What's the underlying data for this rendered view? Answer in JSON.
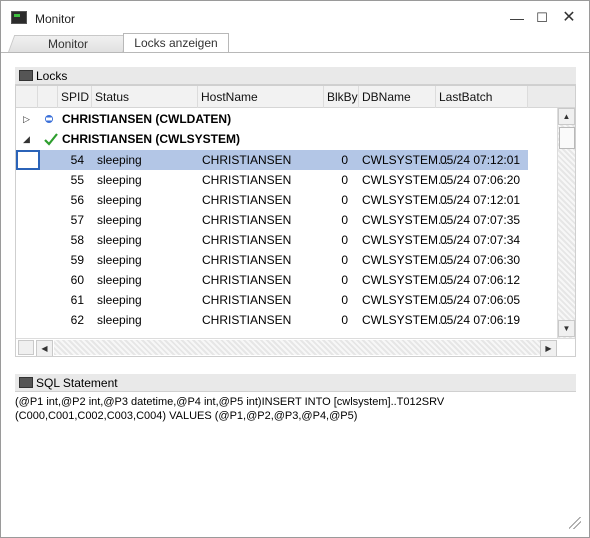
{
  "window": {
    "title": "Monitor"
  },
  "tabs": [
    {
      "label": "Monitor",
      "active": false
    },
    {
      "label": "Locks anzeigen",
      "active": true
    }
  ],
  "locks": {
    "title": "Locks",
    "columns": [
      "SPID",
      "Status",
      "HostName",
      "BlkBy",
      "DBName",
      "LastBatch"
    ],
    "groups": [
      {
        "label": "CHRISTIANSEN (CWLDATEN)",
        "expanded": false
      },
      {
        "label": "CHRISTIANSEN (CWLSYSTEM)",
        "expanded": true
      }
    ],
    "rows": [
      {
        "spid": "54",
        "status": "sleeping",
        "host": "CHRISTIANSEN",
        "blkby": "0",
        "db": "CWLSYSTEM...",
        "last": "05/24 07:12:01"
      },
      {
        "spid": "55",
        "status": "sleeping",
        "host": "CHRISTIANSEN",
        "blkby": "0",
        "db": "CWLSYSTEM...",
        "last": "05/24 07:06:20"
      },
      {
        "spid": "56",
        "status": "sleeping",
        "host": "CHRISTIANSEN",
        "blkby": "0",
        "db": "CWLSYSTEM...",
        "last": "05/24 07:12:01"
      },
      {
        "spid": "57",
        "status": "sleeping",
        "host": "CHRISTIANSEN",
        "blkby": "0",
        "db": "CWLSYSTEM...",
        "last": "05/24 07:07:35"
      },
      {
        "spid": "58",
        "status": "sleeping",
        "host": "CHRISTIANSEN",
        "blkby": "0",
        "db": "CWLSYSTEM...",
        "last": "05/24 07:07:34"
      },
      {
        "spid": "59",
        "status": "sleeping",
        "host": "CHRISTIANSEN",
        "blkby": "0",
        "db": "CWLSYSTEM...",
        "last": "05/24 07:06:30"
      },
      {
        "spid": "60",
        "status": "sleeping",
        "host": "CHRISTIANSEN",
        "blkby": "0",
        "db": "CWLSYSTEM...",
        "last": "05/24 07:06:12"
      },
      {
        "spid": "61",
        "status": "sleeping",
        "host": "CHRISTIANSEN",
        "blkby": "0",
        "db": "CWLSYSTEM...",
        "last": "05/24 07:06:05"
      },
      {
        "spid": "62",
        "status": "sleeping",
        "host": "CHRISTIANSEN",
        "blkby": "0",
        "db": "CWLSYSTEM...",
        "last": "05/24 07:06:19"
      }
    ]
  },
  "sql": {
    "title": "SQL Statement",
    "line1": "(@P1 int,@P2 int,@P3 datetime,@P4 int,@P5 int)INSERT INTO [cwlsystem]..T012SRV",
    "line2": "(C000,C001,C002,C003,C004) VALUES (@P1,@P2,@P3,@P4,@P5)"
  },
  "colors": {
    "selection": "#b3c6e6",
    "focus": "#2b63b8",
    "check": "#2e9e2e",
    "dbicon": "#3a6fd8"
  }
}
